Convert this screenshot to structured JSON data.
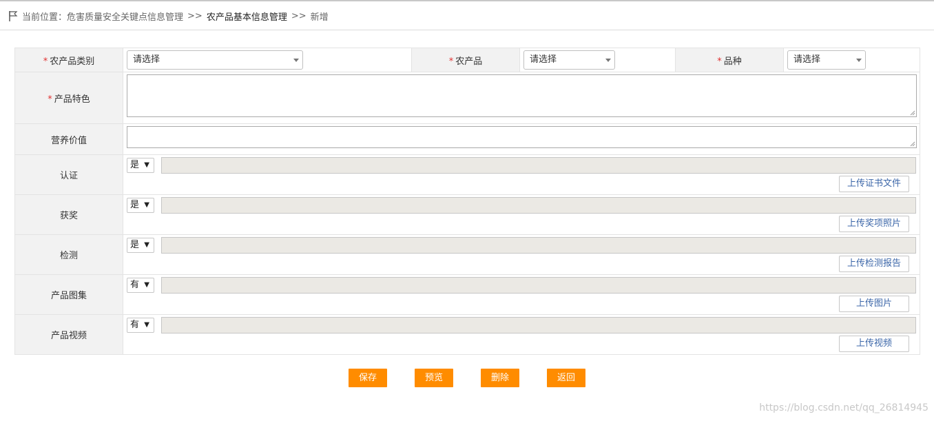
{
  "breadcrumb": {
    "prefix": "当前位置：",
    "level1": "危害质量安全关键点信息管理",
    "sep": ">>",
    "level2": "农产品基本信息管理",
    "level3": "新增"
  },
  "form": {
    "required_mark": "*",
    "category": {
      "label": "农产品类别",
      "value": "请选择"
    },
    "product": {
      "label": "农产品",
      "value": "请选择"
    },
    "variety": {
      "label": "品种",
      "value": "请选择"
    },
    "feature": {
      "label": "产品特色"
    },
    "nutrition": {
      "label": "营养价值"
    },
    "rows": [
      {
        "label": "认证",
        "select": "是",
        "upload": "上传证书文件"
      },
      {
        "label": "获奖",
        "select": "是",
        "upload": "上传奖项照片"
      },
      {
        "label": "检测",
        "select": "是",
        "upload": "上传检测报告"
      },
      {
        "label": "产品图集",
        "select": "有",
        "upload": "上传图片"
      },
      {
        "label": "产品视频",
        "select": "有",
        "upload": "上传视频"
      }
    ],
    "dropdown_glyph": "▼"
  },
  "actions": {
    "save": "保存",
    "preview": "预览",
    "delete": "删除",
    "back": "返回"
  },
  "watermark": "https://blog.csdn.net/qq_26814945",
  "colors": {
    "accent_button": "#ff8c00",
    "label_bg": "#f2f2f2",
    "required": "#e03030",
    "upload_text": "#3b66a8"
  }
}
